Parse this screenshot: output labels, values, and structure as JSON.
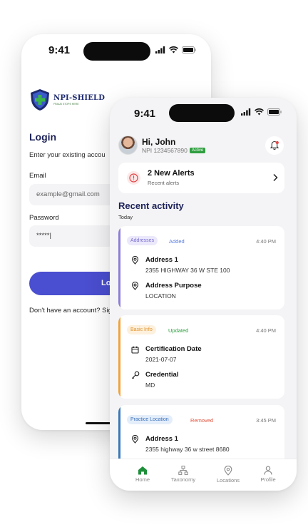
{
  "login_screen": {
    "time": "9:41",
    "logo_text": "NPI-SHIELD",
    "logo_subtext": "FRAUD STOPS HERE",
    "title": "Login",
    "subtitle": "Enter your existing accou",
    "email_label": "Email",
    "email_placeholder": "example@gmail.com",
    "password_label": "Password",
    "password_value": "*****|",
    "login_button": "Lo",
    "signup_text": "Don't have an account? Sig"
  },
  "dashboard": {
    "time": "9:41",
    "greeting": "Hi, John",
    "npi": "NPI 1234567890",
    "status_badge": "Active",
    "alerts": {
      "title": "2 New Alerts",
      "subtitle": "Recent alerts"
    },
    "recent_title": "Recent activity",
    "recent_subtitle": "Today",
    "activities": [
      {
        "tag": "Addresses",
        "status": "Added",
        "time": "4:40 PM",
        "rows": [
          {
            "icon": "location-pin-icon",
            "title": "Address 1",
            "value": "2355 HIGHWAY 36 W STE 100"
          },
          {
            "icon": "location-pin-icon",
            "title": "Address Purpose",
            "value": "LOCATION"
          }
        ]
      },
      {
        "tag": "Basic Info",
        "status": "Updated",
        "time": "4:40 PM",
        "rows": [
          {
            "icon": "calendar-icon",
            "title": "Certification Date",
            "value": "2021-07-07"
          },
          {
            "icon": "key-icon",
            "title": "Credential",
            "value": "MD"
          }
        ]
      },
      {
        "tag": "Practice Location",
        "status": "Removed",
        "time": "3:45 PM",
        "rows": [
          {
            "icon": "location-pin-icon",
            "title": "Address 1",
            "value": "2355 highway 36 w street 8680"
          }
        ]
      }
    ],
    "nav": [
      "Home",
      "Taxonomy",
      "Locations",
      "Profile"
    ]
  },
  "colors": {
    "brand": "#1c2158",
    "primary_button": "#4a4ed0",
    "active_green": "#2e9e3e",
    "addresses_accent": "#8b7fd6",
    "basic_info_accent": "#f0a33a",
    "practice_location_accent": "#3a78b8",
    "removed_red": "#e0533d",
    "alert_red": "#e04848"
  }
}
